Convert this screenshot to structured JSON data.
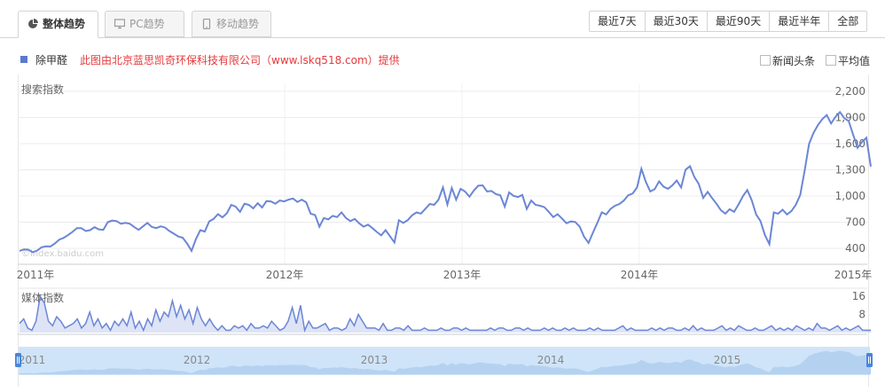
{
  "tabs": [
    {
      "label": "整体趋势",
      "icon": "pie-chart-icon",
      "active": true
    },
    {
      "label": "PC趋势",
      "icon": "monitor-icon",
      "active": false
    },
    {
      "label": "移动趋势",
      "icon": "mobile-icon",
      "active": false
    }
  ],
  "ranges": [
    "最近7天",
    "最近30天",
    "最近90天",
    "最近半年",
    "全部"
  ],
  "legend": {
    "series_name": "除甲醛",
    "credit": "此图由北京蓝思凯奇环保科技有限公司（www.lskq518.com）提供"
  },
  "options": {
    "headlines": "新闻头条",
    "average": "平均值"
  },
  "colors": {
    "line": "#6b86d6",
    "legend": "#5b79cf",
    "credit": "#e4393c",
    "navigator": "#cfe4f9",
    "handle": "#4a86d8"
  },
  "watermark": "©index.baidu.com",
  "chart_data": [
    {
      "type": "line",
      "title": "搜索指数",
      "series": [
        {
          "name": "除甲醛"
        }
      ],
      "ylim": [
        400,
        2200
      ],
      "yticks": [
        400,
        700,
        1000,
        1300,
        1600,
        1900,
        2200
      ],
      "ytick_labels": [
        "400",
        "700",
        "1,000",
        "1,300",
        "1,600",
        "1,900",
        "2,200"
      ],
      "xticks": [
        "2011年",
        "2012年",
        "2013年",
        "2014年",
        "2015年"
      ],
      "grid": true,
      "x_start": "2011-01",
      "x_end": "2015-04",
      "values": [
        370,
        388,
        385,
        355,
        375,
        412,
        422,
        420,
        455,
        500,
        520,
        552,
        588,
        632,
        632,
        598,
        608,
        642,
        618,
        612,
        700,
        718,
        712,
        682,
        692,
        682,
        645,
        612,
        652,
        692,
        645,
        632,
        652,
        638,
        598,
        568,
        535,
        522,
        455,
        372,
        508,
        608,
        592,
        708,
        738,
        792,
        755,
        802,
        898,
        878,
        818,
        912,
        898,
        858,
        918,
        868,
        942,
        938,
        912,
        948,
        938,
        958,
        972,
        932,
        958,
        928,
        798,
        782,
        648,
        748,
        732,
        772,
        758,
        812,
        748,
        712,
        738,
        688,
        648,
        672,
        632,
        588,
        548,
        608,
        538,
        468,
        722,
        692,
        722,
        778,
        812,
        798,
        852,
        908,
        898,
        958,
        1098,
        902,
        1092,
        958,
        1082,
        1052,
        992,
        1062,
        1118,
        1122,
        1052,
        1058,
        1022,
        1008,
        878,
        1042,
        1002,
        988,
        1012,
        852,
        948,
        898,
        888,
        872,
        818,
        758,
        792,
        742,
        688,
        708,
        702,
        648,
        532,
        462,
        578,
        692,
        812,
        788,
        852,
        888,
        908,
        948,
        1008,
        1028,
        1098,
        1312,
        1162,
        1052,
        1078,
        1168,
        1108,
        1082,
        1122,
        1178,
        1098,
        1302,
        1342,
        1218,
        1138,
        978,
        1048,
        978,
        912,
        838,
        798,
        848,
        818,
        902,
        998,
        1068,
        952,
        788,
        712,
        552,
        448,
        812,
        798,
        842,
        788,
        828,
        898,
        1012,
        1292,
        1598,
        1722,
        1812,
        1882,
        1928,
        1832,
        1908,
        1962,
        1892,
        1858,
        1702,
        1552,
        1618,
        1668,
        1338
      ]
    },
    {
      "type": "area",
      "title": "媒体指数",
      "series": [
        {
          "name": "除甲醛"
        }
      ],
      "ylim": [
        0,
        16
      ],
      "yticks": [
        8,
        16
      ],
      "values": [
        4,
        6,
        2,
        1,
        5,
        16,
        13,
        5,
        3,
        7,
        5,
        2,
        3,
        4,
        6,
        2,
        4,
        9,
        3,
        6,
        2,
        4,
        1,
        5,
        3,
        6,
        3,
        9,
        2,
        5,
        1,
        6,
        3,
        10,
        5,
        9,
        7,
        14,
        7,
        12,
        6,
        10,
        4,
        11,
        6,
        3,
        6,
        3,
        1,
        3,
        1,
        1,
        3,
        2,
        3,
        1,
        4,
        2,
        2,
        3,
        2,
        5,
        3,
        1,
        2,
        5,
        11,
        4,
        12,
        1,
        5,
        2,
        2,
        3,
        4,
        1,
        2,
        2,
        1,
        2,
        6,
        3,
        8,
        5,
        2,
        2,
        2,
        1,
        4,
        1,
        1,
        2,
        2,
        1,
        3,
        1,
        1,
        1,
        2,
        1,
        1,
        1,
        2,
        1,
        1,
        2,
        2,
        1,
        2,
        1,
        1,
        1,
        1,
        1,
        2,
        1,
        2,
        2,
        1,
        1,
        2,
        2,
        1,
        2,
        1,
        1,
        1,
        2,
        1,
        2,
        1,
        1,
        2,
        1,
        2,
        1,
        1,
        1,
        2,
        1,
        2,
        1,
        1,
        1,
        1,
        2,
        3,
        1,
        2,
        1,
        1,
        1,
        1,
        2,
        1,
        2,
        1,
        2,
        2,
        1,
        1,
        2,
        1,
        3,
        1,
        2,
        1,
        1,
        1,
        2,
        3,
        1,
        2,
        1,
        3,
        2,
        1,
        1,
        2,
        1,
        1,
        2,
        3,
        1,
        2,
        1,
        2,
        1,
        3,
        2,
        1,
        2,
        1,
        4,
        2,
        2,
        1,
        2,
        3,
        1,
        2,
        1,
        2,
        3,
        1,
        1,
        1
      ]
    }
  ],
  "navigator": {
    "labels": [
      "2011",
      "2012",
      "2013",
      "2014",
      "2015"
    ]
  }
}
